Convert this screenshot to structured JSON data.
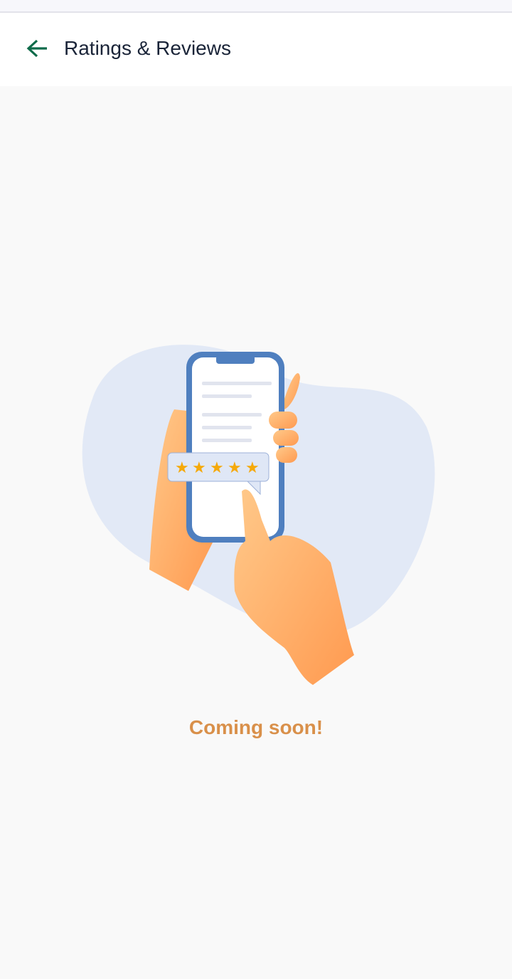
{
  "header": {
    "title": "Ratings & Reviews",
    "back_icon": "arrow-left-icon"
  },
  "colors": {
    "accent": "#0f6b4a",
    "title": "#1a2438",
    "message": "#d9904a",
    "star": "#f5a90a"
  },
  "illustration": {
    "rating_stars": 5
  },
  "message": "Coming soon!"
}
